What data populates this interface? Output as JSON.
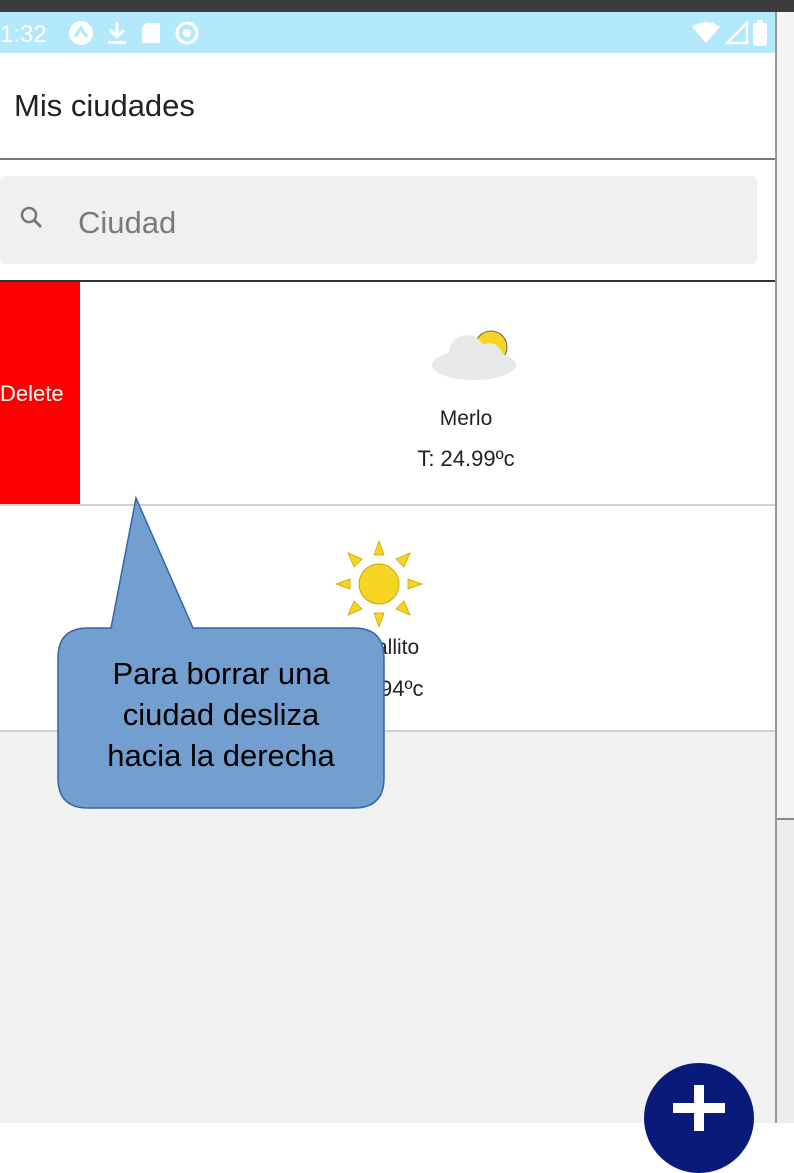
{
  "status_bar": {
    "time": "1:32",
    "left_icons": [
      "a-notification-icon",
      "download-icon",
      "sd-card-icon",
      "sync-icon"
    ],
    "right_icons": [
      "wifi-icon",
      "cell-signal-icon",
      "battery-icon"
    ]
  },
  "header": {
    "title": "Mis ciudades"
  },
  "search": {
    "placeholder": "Ciudad",
    "value": ""
  },
  "cities": [
    {
      "name": "Merlo",
      "temp": "T: 24.99ºc",
      "icon": "partly-cloudy-icon",
      "delete_label": "Delete"
    },
    {
      "name": "allito",
      "temp": "94ºc",
      "icon": "sunny-icon"
    }
  ],
  "callout": {
    "lines": [
      "Para borrar una",
      "ciudad desliza",
      "hacia la derecha"
    ],
    "fill": "#729fcf"
  },
  "fab": {
    "icon": "plus-icon",
    "color": "#0a1a7a"
  }
}
